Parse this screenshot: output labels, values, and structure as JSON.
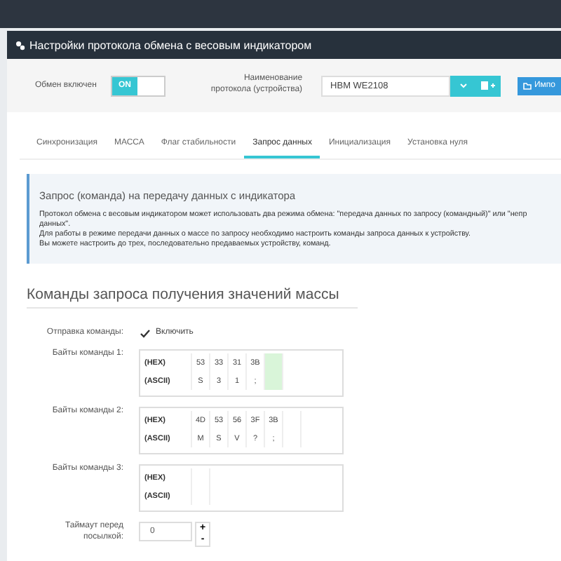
{
  "panel": {
    "title": "Настройки протокола обмена с весовым индикатором"
  },
  "exchange": {
    "label": "Обмен включен",
    "on": true,
    "on_text": "ON"
  },
  "protocol": {
    "label": "Наименование протокола (устройства)",
    "value": "HBM WE2108",
    "import_label": "Импо"
  },
  "tabs": [
    {
      "label": "Синхронизация",
      "selected": false
    },
    {
      "label": "МАССА",
      "selected": false
    },
    {
      "label": "Флаг стабильности",
      "selected": false
    },
    {
      "label": "Запрос данных",
      "selected": true
    },
    {
      "label": "Инициализация",
      "selected": false
    },
    {
      "label": "Установка нуля",
      "selected": false
    }
  ],
  "info": {
    "title": "Запрос (команда) на передачу данных с индикатора",
    "lines": [
      "Протокол обмена с весовым индикатором может использовать два режима обмена: \"передача данных по запросу (командный)\" или \"непр",
      "данных\".",
      "Для работы в режиме передачи данных о массе по запросу необходимо настроить команды запроса данных к устройству.",
      "Вы можете настроить до трех, последовательно предаваемых устройству, команд."
    ]
  },
  "section_title": "Команды запроса получения значений массы",
  "send": {
    "label": "Отправка команды:",
    "checked": true,
    "text": "Включить"
  },
  "commands": [
    {
      "label": "Байты команды 1:",
      "hex_label": "(HEX)",
      "ascii_label": "(ASCII)",
      "input_active": true,
      "cells": [
        {
          "hex": "53",
          "ascii": "S"
        },
        {
          "hex": "33",
          "ascii": "3"
        },
        {
          "hex": "31",
          "ascii": "1"
        },
        {
          "hex": "3B",
          "ascii": ";"
        }
      ]
    },
    {
      "label": "Байты команды 2:",
      "hex_label": "(HEX)",
      "ascii_label": "(ASCII)",
      "input_active": false,
      "cells": [
        {
          "hex": "4D",
          "ascii": "M"
        },
        {
          "hex": "53",
          "ascii": "S"
        },
        {
          "hex": "56",
          "ascii": "V"
        },
        {
          "hex": "3F",
          "ascii": "?"
        },
        {
          "hex": "3B",
          "ascii": ";"
        }
      ]
    },
    {
      "label": "Байты команды 3:",
      "hex_label": "(HEX)",
      "ascii_label": "(ASCII)",
      "input_active": false
    }
  ],
  "timeout": {
    "label": "Таймаут перед посылкой:",
    "value": "0",
    "plus": "+",
    "minus": "-"
  }
}
